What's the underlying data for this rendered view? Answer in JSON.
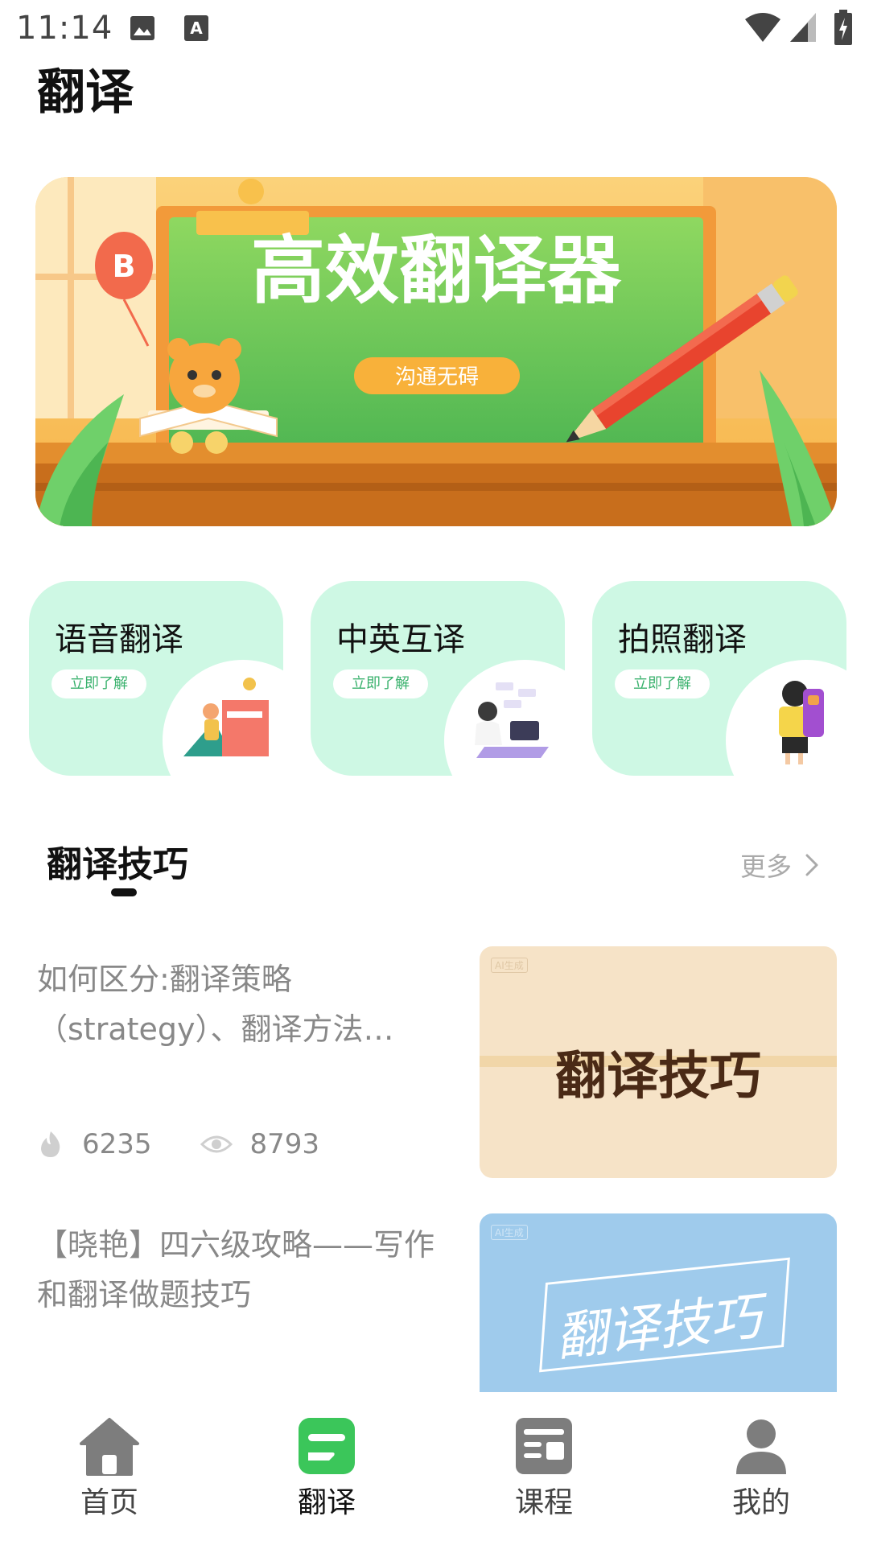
{
  "status_bar": {
    "time": "11:14",
    "icons": [
      "image-icon",
      "a-keyboard-icon",
      "wifi-icon",
      "signal-icon",
      "battery-icon"
    ]
  },
  "page_title": "翻译",
  "banner": {
    "headline": "高效翻译器",
    "tag": "沟通无碍",
    "balloon": "B"
  },
  "features": [
    {
      "title": "语音翻译",
      "button": "立即了解"
    },
    {
      "title": "中英互译",
      "button": "立即了解"
    },
    {
      "title": "拍照翻译",
      "button": "立即了解"
    }
  ],
  "section": {
    "title": "翻译技巧",
    "more": "更多"
  },
  "articles": [
    {
      "title": "如何区分:翻译策略（strategy）、翻译方法…",
      "likes": "6235",
      "views": "8793",
      "thumb_text": "翻译技巧",
      "thumb_badge": "AI生成"
    },
    {
      "title": "【晓艳】四六级攻略——写作和翻译做题技巧",
      "thumb_text": "翻译技巧",
      "thumb_badge": "AI生成"
    }
  ],
  "nav": [
    {
      "label": "首页",
      "icon": "home-icon"
    },
    {
      "label": "翻译",
      "icon": "translate-icon"
    },
    {
      "label": "课程",
      "icon": "course-icon"
    },
    {
      "label": "我的",
      "icon": "profile-icon"
    }
  ],
  "colors": {
    "accent_green": "#3bc65a",
    "card_mint": "#cef8e4",
    "banner_orange": "#f9b24a",
    "board_green": "#5fc860"
  }
}
